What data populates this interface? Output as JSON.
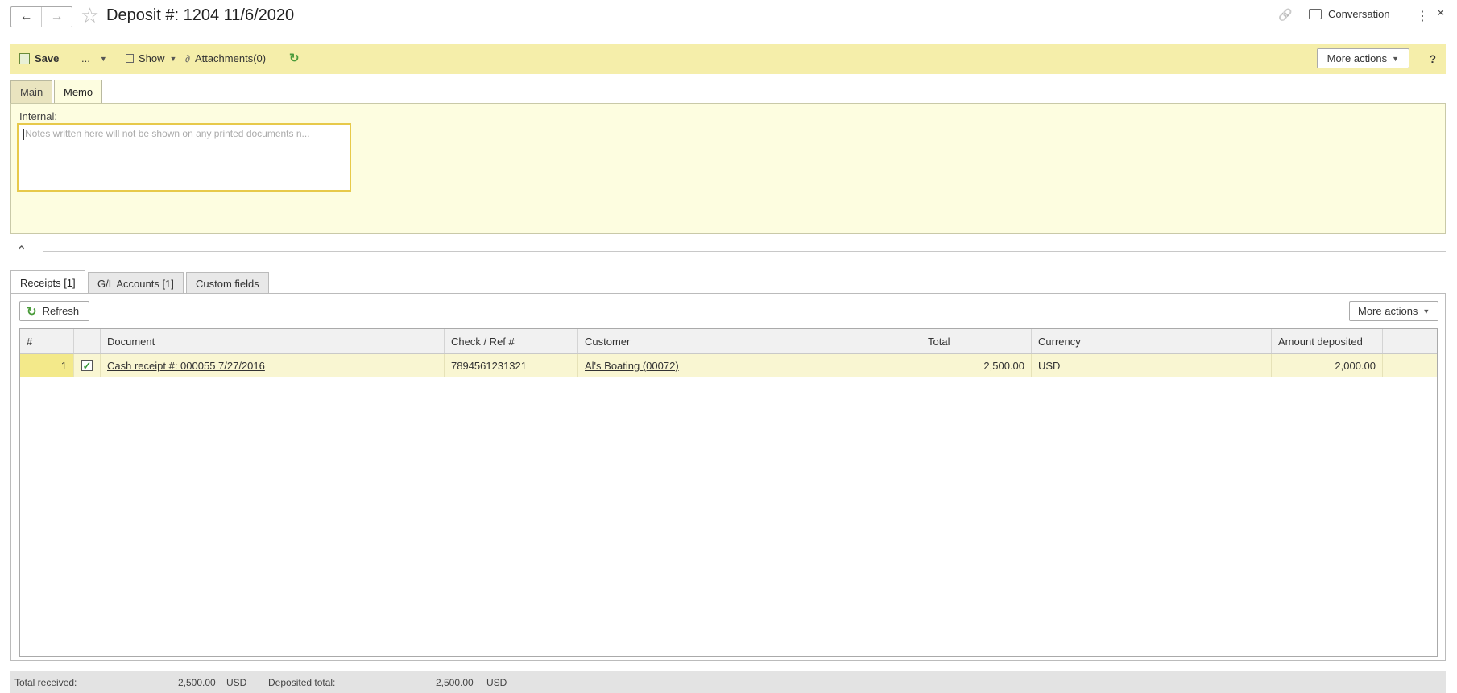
{
  "header": {
    "back_icon": "←",
    "forward_icon": "→",
    "favorite_icon": "☆",
    "title": "Deposit #: 1204 11/6/2020",
    "link_icon": "🔗",
    "conversation_label": "Conversation",
    "menu_icon": "⋮",
    "close_icon": "×"
  },
  "toolbar": {
    "save_label": "Save",
    "more_label": "...",
    "show_label": "Show",
    "attachments_label": "Attachments(0)",
    "refresh_icon": "↻",
    "more_actions_label": "More actions",
    "help_label": "?"
  },
  "top_tabs": [
    {
      "label": "Main",
      "active": false
    },
    {
      "label": "Memo",
      "active": true
    }
  ],
  "memo": {
    "internal_label": "Internal:",
    "placeholder": "Notes written here will not be shown on any printed documents n..."
  },
  "collapse_icon": "⌃",
  "bottom_tabs": [
    {
      "label": "Receipts [1]",
      "active": true
    },
    {
      "label": "G/L Accounts [1]",
      "active": false
    },
    {
      "label": "Custom fields",
      "active": false
    }
  ],
  "receipts": {
    "refresh_label": "Refresh",
    "more_actions_label": "More actions",
    "columns": [
      "#",
      "",
      "Document",
      "Check / Ref #",
      "Customer",
      "Total",
      "Currency",
      "Amount deposited"
    ],
    "rows": [
      {
        "num": "1",
        "checked": "✓",
        "document": "Cash receipt #: 000055 7/27/2016",
        "check_ref": "7894561231321",
        "customer": "Al's Boating (00072)",
        "total": "2,500.00",
        "currency": "USD",
        "amount_deposited": "2,000.00"
      }
    ]
  },
  "footer": {
    "total_received_label": "Total received:",
    "total_received_value": "2,500.00",
    "total_received_currency": "USD",
    "deposited_total_label": "Deposited total:",
    "deposited_total_value": "2,500.00",
    "deposited_total_currency": "USD"
  },
  "colors": {
    "toolbar_bg": "#f5eeaa",
    "panel_bg": "#fdfde0",
    "row_highlight": "#f9f6d2",
    "memo_border": "#e7c94a",
    "accent_green": "#4a9b3a"
  }
}
